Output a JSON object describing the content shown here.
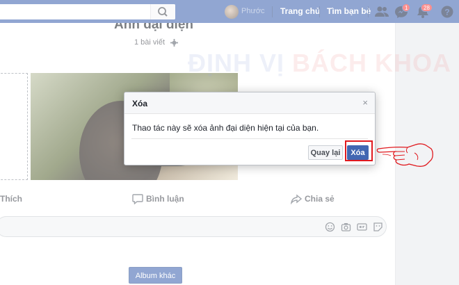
{
  "topbar": {
    "user_name": "Phước",
    "home_label": "Trang chủ",
    "find_friends_label": "Tìm bạn bè",
    "messages_badge": "1",
    "notifications_badge": "28",
    "bg_color": "#4267b2"
  },
  "album": {
    "title": "Ảnh đại diện",
    "post_count": "1 bài viết",
    "more_albums_label": "Album khác"
  },
  "actions": {
    "like_label": "Thích",
    "comment_label": "Bình luận",
    "share_label": "Chia sẻ"
  },
  "watermark": {
    "part1": "ĐỊNH VỊ",
    "part2": "BÁCH KHOA"
  },
  "dialog": {
    "title": "Xóa",
    "close_glyph": "×",
    "message": "Thao tác này sẽ xóa ảnh đại diện hiện tại của bạn.",
    "cancel_label": "Quay lại",
    "confirm_label": "Xóa",
    "confirm_color": "#4267b2",
    "highlight_color": "#e0191e"
  }
}
